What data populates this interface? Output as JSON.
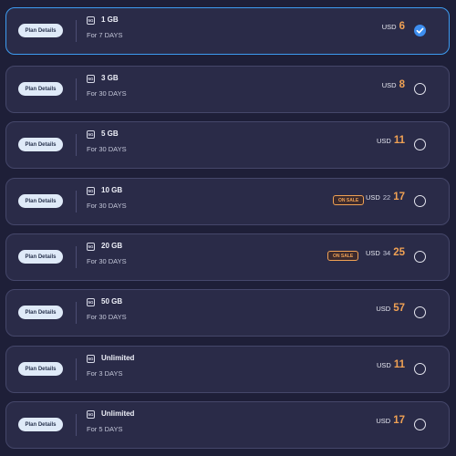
{
  "plans": [
    {
      "details_label": "Plan Details",
      "network": "5G",
      "data": "1 GB",
      "duration": "For 7 DAYS",
      "currency": "USD",
      "old_price": "",
      "price": "6",
      "on_sale": false,
      "sale_label": "",
      "selected": true
    },
    {
      "details_label": "Plan Details",
      "network": "5G",
      "data": "3 GB",
      "duration": "For 30 DAYS",
      "currency": "USD",
      "old_price": "",
      "price": "8",
      "on_sale": false,
      "sale_label": "",
      "selected": false
    },
    {
      "details_label": "Plan Details",
      "network": "5G",
      "data": "5 GB",
      "duration": "For 30 DAYS",
      "currency": "USD",
      "old_price": "",
      "price": "11",
      "on_sale": false,
      "sale_label": "",
      "selected": false
    },
    {
      "details_label": "Plan Details",
      "network": "5G",
      "data": "10 GB",
      "duration": "For 30 DAYS",
      "currency": "USD",
      "old_price": "22",
      "price": "17",
      "on_sale": true,
      "sale_label": "ON SALE",
      "selected": false
    },
    {
      "details_label": "Plan Details",
      "network": "5G",
      "data": "20 GB",
      "duration": "For 30 DAYS",
      "currency": "USD",
      "old_price": "34",
      "price": "25",
      "on_sale": true,
      "sale_label": "ON SALE",
      "selected": false
    },
    {
      "details_label": "Plan Details",
      "network": "5G",
      "data": "50 GB",
      "duration": "For 30 DAYS",
      "currency": "USD",
      "old_price": "",
      "price": "57",
      "on_sale": false,
      "sale_label": "",
      "selected": false
    },
    {
      "details_label": "Plan Details",
      "network": "5G",
      "data": "Unlimited",
      "duration": "For 3 DAYS",
      "currency": "USD",
      "old_price": "",
      "price": "11",
      "on_sale": false,
      "sale_label": "",
      "selected": false
    },
    {
      "details_label": "Plan Details",
      "network": "5G",
      "data": "Unlimited",
      "duration": "For 5 DAYS",
      "currency": "USD",
      "old_price": "",
      "price": "17",
      "on_sale": false,
      "sale_label": "",
      "selected": false
    }
  ],
  "colors": {
    "background": "#1e1f38",
    "card": "#2a2b48",
    "selected_border": "#3d9bf0",
    "price_accent": "#f0a154",
    "check_fill": "#3d8ef0"
  },
  "icons": {
    "network": "5g-icon",
    "selected": "checkmark-circle-icon",
    "unselected": "radio-empty-icon"
  }
}
